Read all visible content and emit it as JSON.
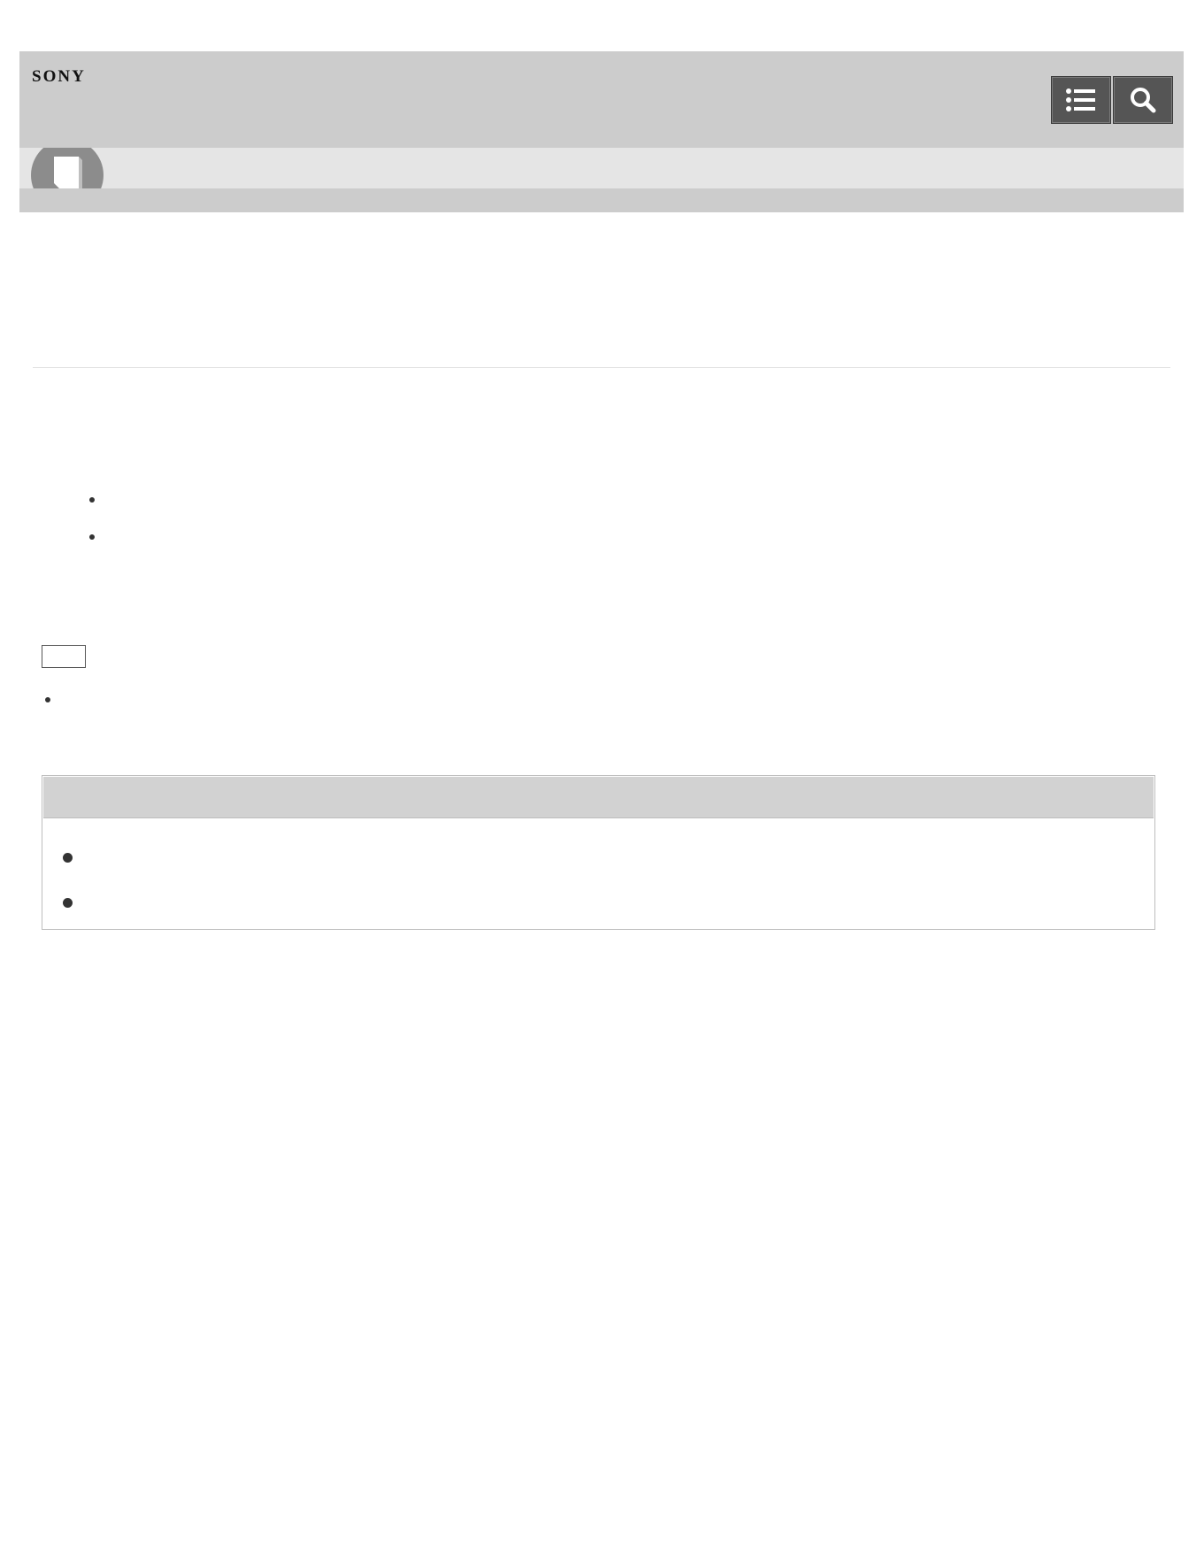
{
  "header": {
    "brand": "SONY",
    "buttons": [
      {
        "icon": "list-icon"
      },
      {
        "icon": "search-icon"
      }
    ],
    "section_icon": "book-icon"
  },
  "colors": {
    "header_bg": "#cccccc",
    "subbar_bg": "#e5e5e5",
    "button_bg": "#555555",
    "hint_header_bg": "#d2d2d2"
  }
}
